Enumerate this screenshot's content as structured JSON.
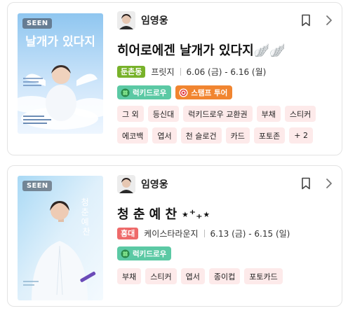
{
  "colors": {
    "area_badge_1": "#78b22a",
    "area_badge_2": "#ee6a6a",
    "lucky_tag": "#5bc9a4",
    "stamp_tag": "#f18530",
    "goods_chip_bg": "#fdeaea"
  },
  "cards": [
    {
      "seen_label": "SEEN",
      "poster_text": "날개가 있다지",
      "artist_name": "임영웅",
      "title": "히어로에겐 날개가 있다지🪽🪽",
      "area": "둔촌동",
      "venue": "프릿지",
      "dates": "6.06 (금) - 6.16 (월)",
      "tags": [
        {
          "label": "럭키드로우",
          "icon": "clover-icon"
        },
        {
          "label": "스탬프 투어",
          "icon": "target-icon"
        }
      ],
      "goods": [
        "그 외",
        "등신대",
        "럭키드로우 교환권",
        "부채",
        "스티커",
        "에코백",
        "엽서",
        "천 슬로건",
        "카드",
        "포토존",
        "+ 2"
      ]
    },
    {
      "seen_label": "SEEN",
      "poster_text": "청춘예찬",
      "artist_name": "임영웅",
      "title": "청 춘 예 찬 ⋆⁺₊⋆",
      "area": "홍대",
      "venue": "케이스타라운지",
      "dates": "6.13 (금) - 6.15 (일)",
      "tags": [
        {
          "label": "럭키드로우",
          "icon": "clover-icon"
        }
      ],
      "goods": [
        "부채",
        "스티커",
        "엽서",
        "종이컵",
        "포토카드"
      ]
    }
  ]
}
